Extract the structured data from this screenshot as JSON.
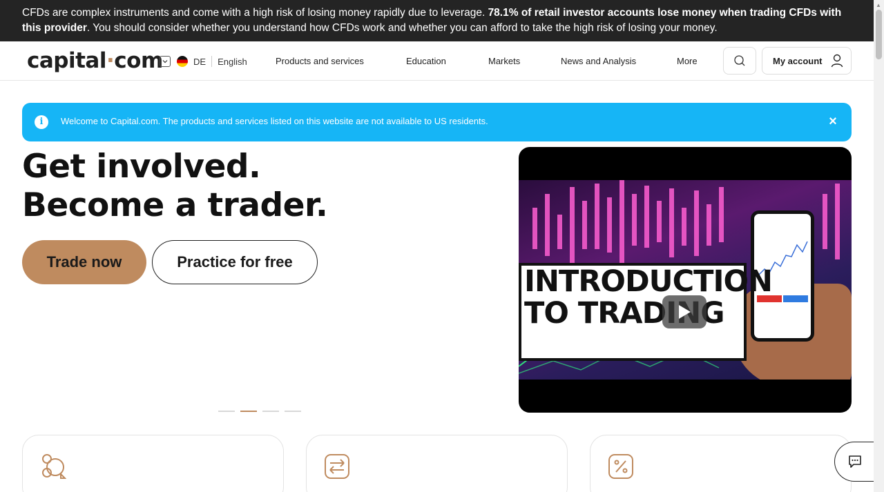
{
  "risk_banner": {
    "part1": "CFDs are complex instruments and come with a high risk of losing money rapidly due to leverage. ",
    "bold": "78.1% of retail investor accounts lose money when trading CFDs with this provider",
    "part2": ". You should consider whether you understand how CFDs work and whether you can afford to take the high risk of losing your money."
  },
  "header": {
    "logo_left": "capital",
    "logo_dot": "·",
    "logo_right": "com",
    "region_code": "DE",
    "language": "English",
    "nav": [
      "Products and services",
      "Education",
      "Markets",
      "News and Analysis",
      "More"
    ],
    "account_label": "My account"
  },
  "notice": {
    "text": "Welcome to Capital.com. The products and services listed on this website are not available to US residents.",
    "close": "×",
    "info": "i"
  },
  "hero": {
    "title_line1": "Get involved.",
    "title_line2": "Become a trader.",
    "trade_label": "Trade now",
    "practice_label": "Practice for free",
    "slides_active": 2,
    "slides_total": 4
  },
  "video": {
    "line1": "INTRODUCTION",
    "line2": "TO TRADING"
  },
  "colors": {
    "accent": "#bf8b5f",
    "notice": "#16b5f6",
    "banner": "#242424"
  },
  "icons": [
    "chevron-down-icon",
    "germany-flag-icon",
    "search-icon",
    "user-icon",
    "info-icon",
    "close-icon",
    "play-icon",
    "coins-icon",
    "exchange-icon",
    "percent-icon",
    "chat-icon"
  ]
}
